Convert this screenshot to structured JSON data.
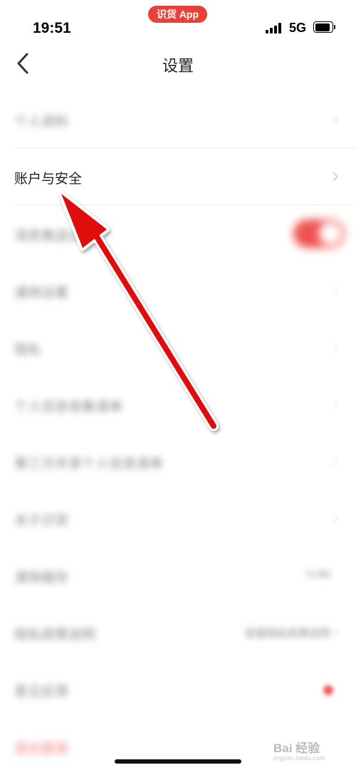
{
  "status_bar": {
    "time": "19:51",
    "app_pill": "识货 App",
    "network": "5G"
  },
  "nav": {
    "title": "设置"
  },
  "settings": {
    "rows": [
      {
        "label": "个人资料",
        "blurred": true
      },
      {
        "label": "账户与安全",
        "blurred": false
      },
      {
        "label": "消息推送设置",
        "blurred": true,
        "toggle": "on"
      },
      {
        "label": "通用设置",
        "blurred": true
      },
      {
        "label": "隐私",
        "blurred": true
      },
      {
        "label": "个人信息收集清单",
        "blurred": true
      },
      {
        "label": "第三方共享个人信息清单",
        "blurred": true
      },
      {
        "label": "关于识货",
        "blurred": true
      },
      {
        "label": "清除缓存",
        "blurred": true,
        "value": "0.0M"
      },
      {
        "label": "隐私政策说明",
        "blurred": true,
        "value": "查看隐私政策说明"
      },
      {
        "label": "意见反馈",
        "blurred": true
      },
      {
        "label": "退出登录",
        "blurred": true
      }
    ]
  },
  "watermark": {
    "brand": "Bai 经验",
    "domain": "jingyan.baidu.com"
  },
  "colors": {
    "accent": "#e8413a",
    "arrow": "#e01010"
  }
}
